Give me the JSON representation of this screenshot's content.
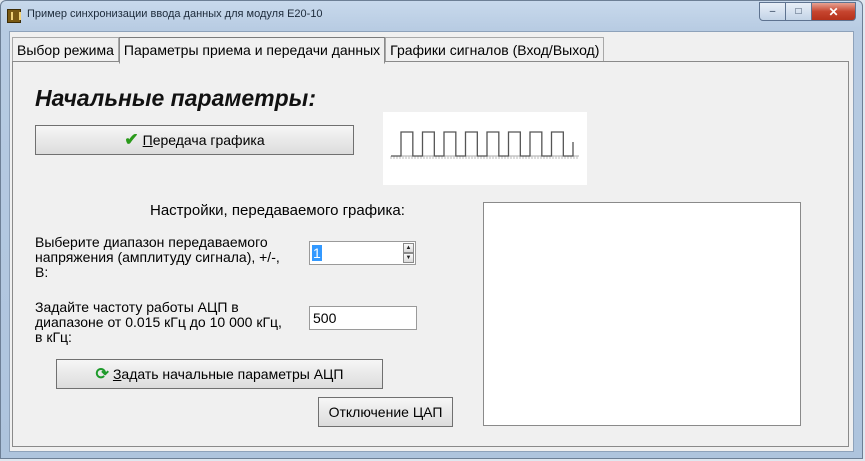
{
  "window": {
    "title": "Пример синхронизации ввода данных для модуля E20-10",
    "minimize": "–",
    "maximize": "□",
    "close": "✕"
  },
  "tabs": [
    {
      "label": "Выбор режима",
      "active": false
    },
    {
      "label": "Параметры приема и передачи данных",
      "active": true
    },
    {
      "label": "Графики сигналов (Вход/Выход)",
      "active": false
    }
  ],
  "panel": {
    "heading": "Начальные параметры:",
    "transmit_button": {
      "first": "П",
      "rest": "ередача графика"
    },
    "section_label": "Настройки, передаваемого графика:",
    "voltage_label_lines": [
      "Выберите диапазон передаваемого",
      "напряжения (амплитуду сигнала), +/-,",
      "В:"
    ],
    "voltage_value": "1",
    "freq_label_lines": [
      "Задайте частоту работы АЦП в",
      "диапазоне от 0.015 кГц до 10 000 кГц,",
      "в кГц:"
    ],
    "freq_value": "500",
    "set_params_button": {
      "first": "З",
      "rest": "адать начальные параметры АЦП"
    },
    "dac_off_button": "Отключение ЦАП"
  },
  "signal": {
    "pulse_count": 8,
    "stroke": "#555555"
  }
}
